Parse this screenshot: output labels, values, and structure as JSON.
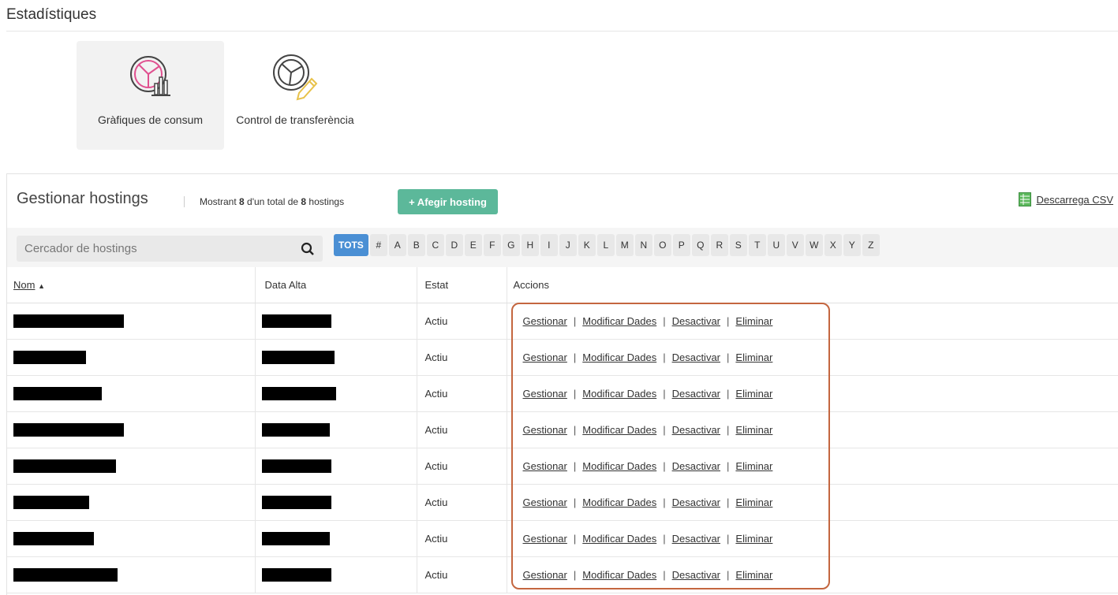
{
  "section": {
    "title": "Estadístiques"
  },
  "tiles": [
    {
      "label": "Gràfiques de consum",
      "icon": "chart-consumption-icon",
      "active": true
    },
    {
      "label": "Control de transferència",
      "icon": "chart-transfer-icon",
      "active": false
    }
  ],
  "panel": {
    "title": "Gestionar hostings",
    "count_prefix": "Mostrant ",
    "count_shown": "8",
    "count_middle": " d'un total de ",
    "count_total": "8",
    "count_suffix": " hostings",
    "add_button": "+ Afegir hosting",
    "csv_label": "Descarrega CSV"
  },
  "search": {
    "placeholder": "Cercador de hostings",
    "value": ""
  },
  "letter_filter": {
    "active": "TOTS",
    "letters": [
      "TOTS",
      "#",
      "A",
      "B",
      "C",
      "D",
      "E",
      "F",
      "G",
      "H",
      "I",
      "J",
      "K",
      "L",
      "M",
      "N",
      "O",
      "P",
      "Q",
      "R",
      "S",
      "T",
      "U",
      "V",
      "W",
      "X",
      "Y",
      "Z"
    ]
  },
  "table": {
    "columns": {
      "name": "Nom",
      "sort_indicator": "▲",
      "date": "Data Alta",
      "status": "Estat",
      "actions": "Accions"
    },
    "action_labels": [
      "Gestionar",
      "Modificar Dades",
      "Desactivar",
      "Eliminar"
    ],
    "rows": [
      {
        "status": "Actiu"
      },
      {
        "status": "Actiu"
      },
      {
        "status": "Actiu"
      },
      {
        "status": "Actiu"
      },
      {
        "status": "Actiu"
      },
      {
        "status": "Actiu"
      },
      {
        "status": "Actiu"
      },
      {
        "status": "Actiu"
      }
    ]
  },
  "colors": {
    "accent_green": "#5cb89a",
    "active_letter": "#4a8fd4",
    "highlight": "#c4663f",
    "icon_pink": "#e0508f",
    "icon_yellow": "#e8c24a"
  }
}
